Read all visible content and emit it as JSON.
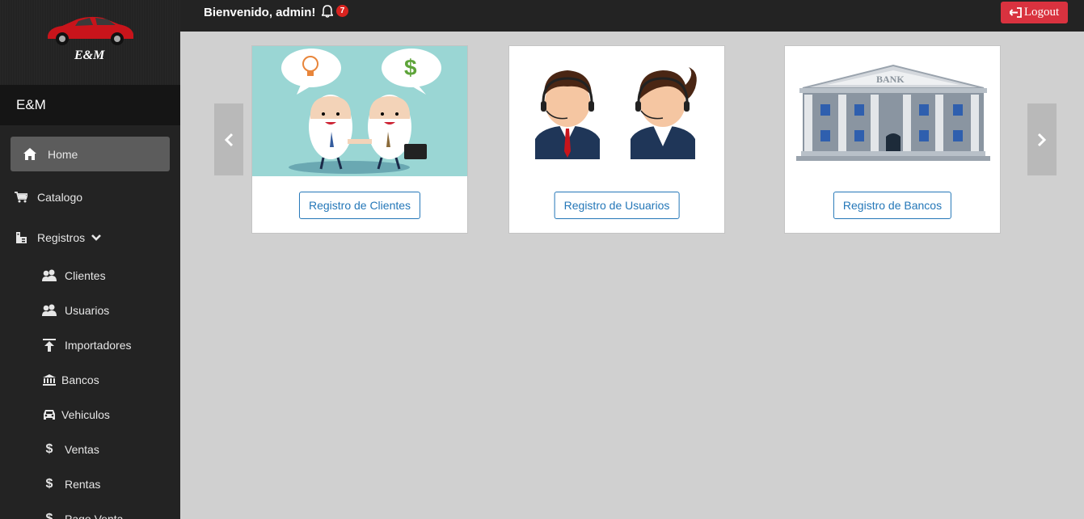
{
  "logo": {
    "text": "E&M"
  },
  "brand": "E&M",
  "header": {
    "welcome": "Bienvenido, admin!",
    "notification_count": "7",
    "logout_label": "Logout"
  },
  "sidebar": {
    "items": [
      {
        "label": "Home",
        "icon": "home-icon"
      },
      {
        "label": "Catalogo",
        "icon": "cart-icon"
      },
      {
        "label": "Registros",
        "icon": "registry-icon"
      }
    ],
    "sub_items": [
      {
        "label": "Clientes",
        "icon": "users-icon"
      },
      {
        "label": "Usuarios",
        "icon": "users-icon"
      },
      {
        "label": "Importadores",
        "icon": "upload-icon"
      },
      {
        "label": "Bancos",
        "icon": "bank-icon"
      },
      {
        "label": "Vehiculos",
        "icon": "car-icon"
      },
      {
        "label": "Ventas",
        "icon": "dollar-icon"
      },
      {
        "label": "Rentas",
        "icon": "dollar-icon"
      },
      {
        "label": "Pago Venta",
        "icon": "dollar-icon"
      }
    ]
  },
  "cards": [
    {
      "button": "Registro de Clientes"
    },
    {
      "button": "Registro de Usuarios"
    },
    {
      "button": "Registro de Bancos"
    }
  ],
  "colors": {
    "sidebar": "#232323",
    "content": "#d0d0d0",
    "logout": "#d9323f",
    "link": "#2477b8"
  }
}
